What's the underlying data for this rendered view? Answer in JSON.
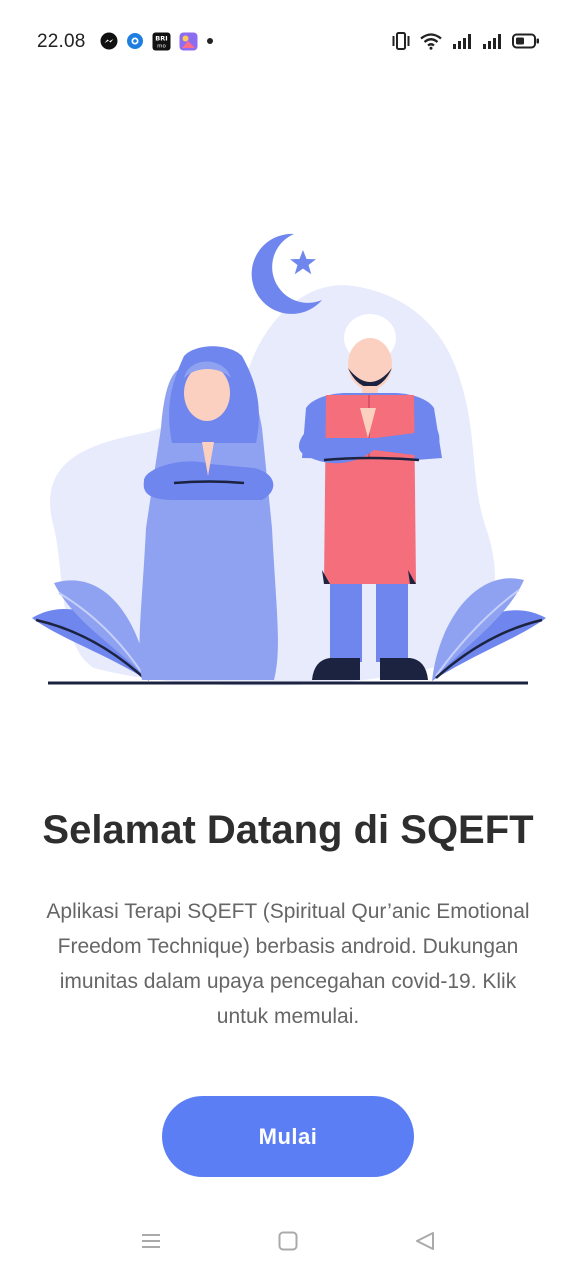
{
  "status_bar": {
    "time": "22.08",
    "notification_icons": [
      "messenger-icon",
      "app-notification-icon",
      "brimo-icon",
      "gallery-icon",
      "dot-icon"
    ],
    "system_icons": [
      "vibrate-icon",
      "wifi-icon",
      "signal-icon",
      "signal-icon",
      "battery-icon"
    ]
  },
  "illustration": {
    "description_icons": [
      "crescent-moon-icon",
      "star-icon"
    ],
    "colors": {
      "primary": "#6f86ee",
      "light": "#8fa2f2",
      "background_blob": "#e8ebfc",
      "robe": "#f46e7c",
      "dark": "#1c2340"
    }
  },
  "welcome": {
    "title": "Selamat Datang di SQEFT",
    "description": "Aplikasi Terapi  SQEFT (Spiritual Qur’anic Emotional Freedom Technique) berbasis android. Dukungan imunitas dalam upaya pencegahan covid-19. Klik untuk memulai."
  },
  "actions": {
    "start_label": "Mulai"
  },
  "colors": {
    "accent": "#5b7ef4",
    "title": "#2e2e2e",
    "body_text": "#666666",
    "nav_icons": "#aaaaaa"
  },
  "nav_bar": {
    "icons": [
      "menu-icon",
      "home-icon",
      "back-icon"
    ]
  }
}
